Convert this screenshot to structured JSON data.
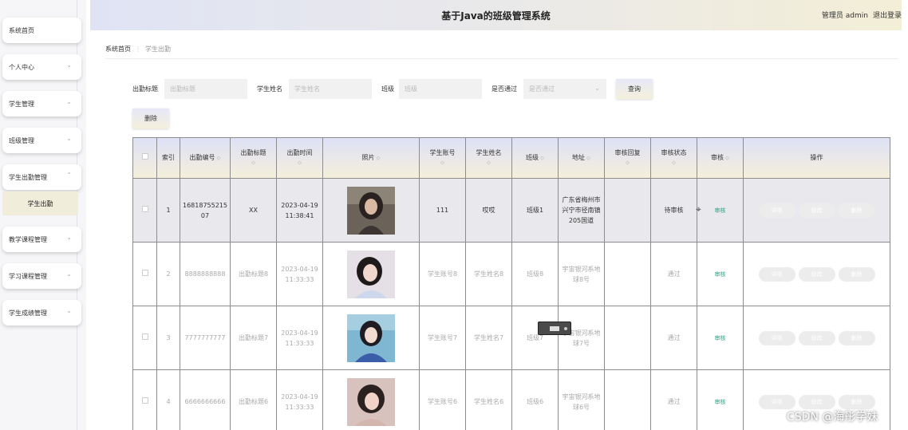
{
  "header": {
    "title": "基于Java的班级管理系统",
    "user": "管理员 admin",
    "logout": "退出登录"
  },
  "sidebar": {
    "items": [
      {
        "label": "系统首页",
        "chevron": ""
      },
      {
        "label": "个人中心",
        "chevron": "⌄"
      },
      {
        "label": "学生管理",
        "chevron": "⌄"
      },
      {
        "label": "班级管理",
        "chevron": "⌄"
      },
      {
        "label": "学生出勤管理",
        "chevron": "⌃"
      },
      {
        "label": "教学课程管理",
        "chevron": "⌄"
      },
      {
        "label": "学习课程管理",
        "chevron": "⌄"
      },
      {
        "label": "学生成绩管理",
        "chevron": "⌄"
      }
    ],
    "submenu": "学生出勤"
  },
  "breadcrumb": {
    "home": "系统首页",
    "sep": "⋮",
    "current": "学生出勤"
  },
  "search": {
    "fields": [
      {
        "label": "出勤标题",
        "placeholder": "出勤标题"
      },
      {
        "label": "学生姓名",
        "placeholder": "学生姓名"
      },
      {
        "label": "班级",
        "placeholder": "班级"
      },
      {
        "label": "是否通过",
        "placeholder": "是否通过"
      }
    ],
    "query_button": "查询",
    "delete_button": "删除"
  },
  "table": {
    "columns": [
      "",
      "索引",
      "出勤编号",
      "出勤标题",
      "出勤时间",
      "照片",
      "学生账号",
      "学生姓名",
      "班级",
      "地址",
      "审核回复",
      "审核状态",
      "审核",
      "操作"
    ],
    "sort_icon": "⬦",
    "rows": [
      {
        "index": "1",
        "code": "1681875521507",
        "title": "XX",
        "time": "2023-04-19 11:38:41",
        "account": "111",
        "name": "哎哎",
        "class": "班级1",
        "address": "广东省梅州市兴宁市径南镇205国道",
        "reply": "",
        "status": "待审核",
        "audit": "审核"
      },
      {
        "index": "2",
        "code": "8888888888",
        "title": "出勤标题8",
        "time": "2023-04-19 11:33:33",
        "account": "学生账号8",
        "name": "学生姓名8",
        "class": "班级8",
        "address": "宇宙银河系地球8号",
        "reply": "",
        "status": "通过",
        "audit": "审核"
      },
      {
        "index": "3",
        "code": "7777777777",
        "title": "出勤标题7",
        "time": "2023-04-19 11:33:33",
        "account": "学生账号7",
        "name": "学生姓名7",
        "class": "班级7",
        "address": "宇宙银河系地球7号",
        "reply": "",
        "status": "通过",
        "audit": "审核"
      },
      {
        "index": "4",
        "code": "6666666666",
        "title": "出勤标题6",
        "time": "2023-04-19 11:33:33",
        "account": "学生账号6",
        "name": "学生姓名6",
        "class": "班级6",
        "address": "宇宙银河系地球6号",
        "reply": "",
        "status": "通过",
        "audit": "审核"
      }
    ],
    "actions": {
      "detail": "详情",
      "edit": "修改",
      "delete": "删除"
    }
  },
  "watermark": "CSDN @海彤学妹"
}
